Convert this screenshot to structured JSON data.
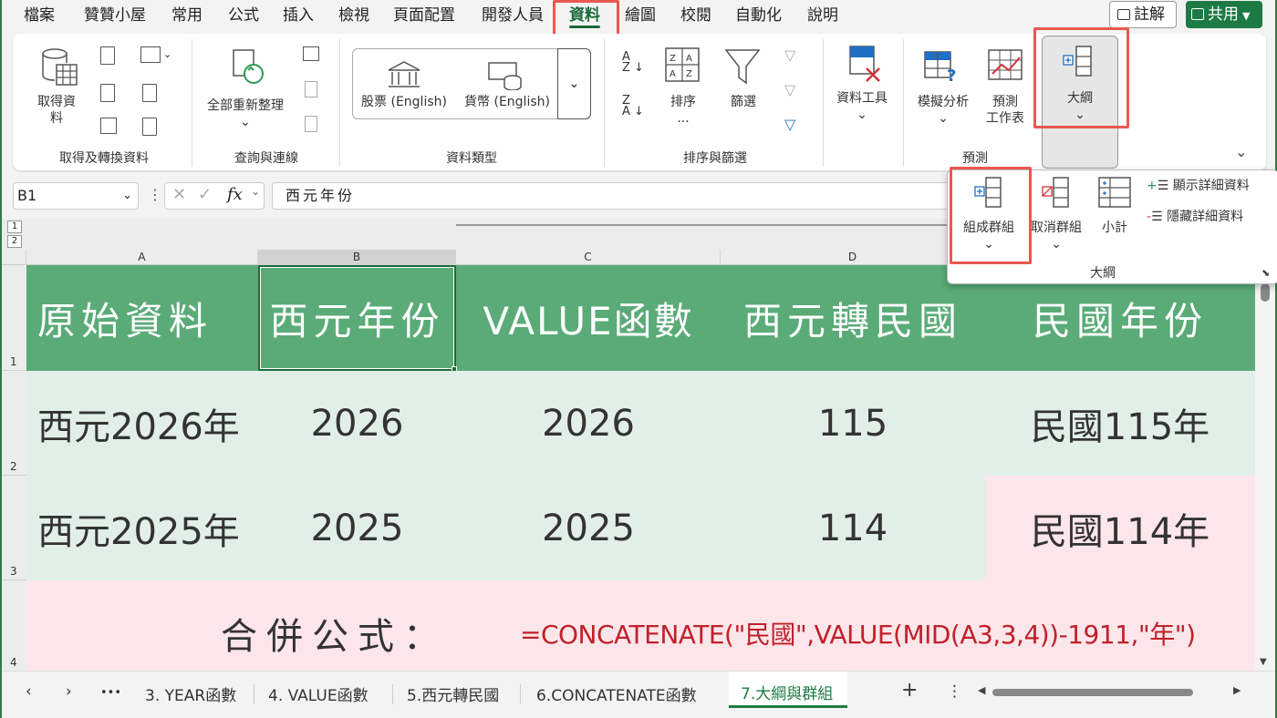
{
  "menu": {
    "items": [
      "檔案",
      "贊贊小屋",
      "常用",
      "公式",
      "插入",
      "檢視",
      "頁面配置",
      "開發人員",
      "資料",
      "繪圖",
      "校閱",
      "自動化",
      "說明"
    ],
    "active": "資料",
    "comment_label": "註解",
    "share_label": "共用"
  },
  "ribbon": {
    "get_data_label": "取得資料",
    "refresh_all_label": "全部重新整理",
    "stocks_label": "股票 (English)",
    "currency_label": "貨幣 (English)",
    "sort_label": "排序",
    "sort_more": "...",
    "filter_label": "篩選",
    "data_tools_label": "資料工具",
    "whatif_label": "模擬分析",
    "forecast_label_line1": "預測",
    "forecast_label_line2": "工作表",
    "outline_label": "大綱",
    "groups": {
      "get_transform": "取得及轉換資料",
      "queries": "查詢與連線",
      "data_types": "資料類型",
      "sort_filter": "排序與篩選",
      "forecast": "預測"
    }
  },
  "formula_bar": {
    "name_box": "B1",
    "fx": "fx",
    "content": "西元年份"
  },
  "columns": [
    "A",
    "B",
    "C",
    "D"
  ],
  "rows": [
    "1",
    "2",
    "3",
    "4"
  ],
  "outline_levels": [
    "1",
    "2"
  ],
  "sheet": {
    "header": [
      "原始資料",
      "西元年份",
      "VALUE函數",
      "西元轉民國",
      "民國年份"
    ],
    "row2": [
      "西元2026年",
      "2026",
      "2026",
      "115",
      "民國115年"
    ],
    "row3": [
      "西元2025年",
      "2025",
      "2025",
      "114",
      "民國114年"
    ],
    "row4_label": "合併公式：",
    "row4_formula": "=CONCATENATE(\"民國\",VALUE(MID(A3,3,4))-1911,\"年\")"
  },
  "outline_panel": {
    "group_label": "組成群組",
    "ungroup_label": "取消群組",
    "subtotal_label": "小計",
    "show_detail_label": "顯示詳細資料",
    "hide_detail_label": "隱藏詳細資料",
    "title": "大綱"
  },
  "tabs": {
    "more": "•••",
    "items": [
      "3. YEAR函數",
      "4. VALUE函數",
      "5.西元轉民國",
      "6.CONCATENATE函數",
      "7.大綱與群組"
    ],
    "active": "7.大綱與群組",
    "add": "+"
  },
  "colors": {
    "header_green": "#5aab78",
    "data_green": "#e2efe8",
    "pink": "#fde6ea",
    "formula_red": "#c0202a",
    "highlight_red": "#e8594f",
    "brand_green": "#1d7a45"
  }
}
